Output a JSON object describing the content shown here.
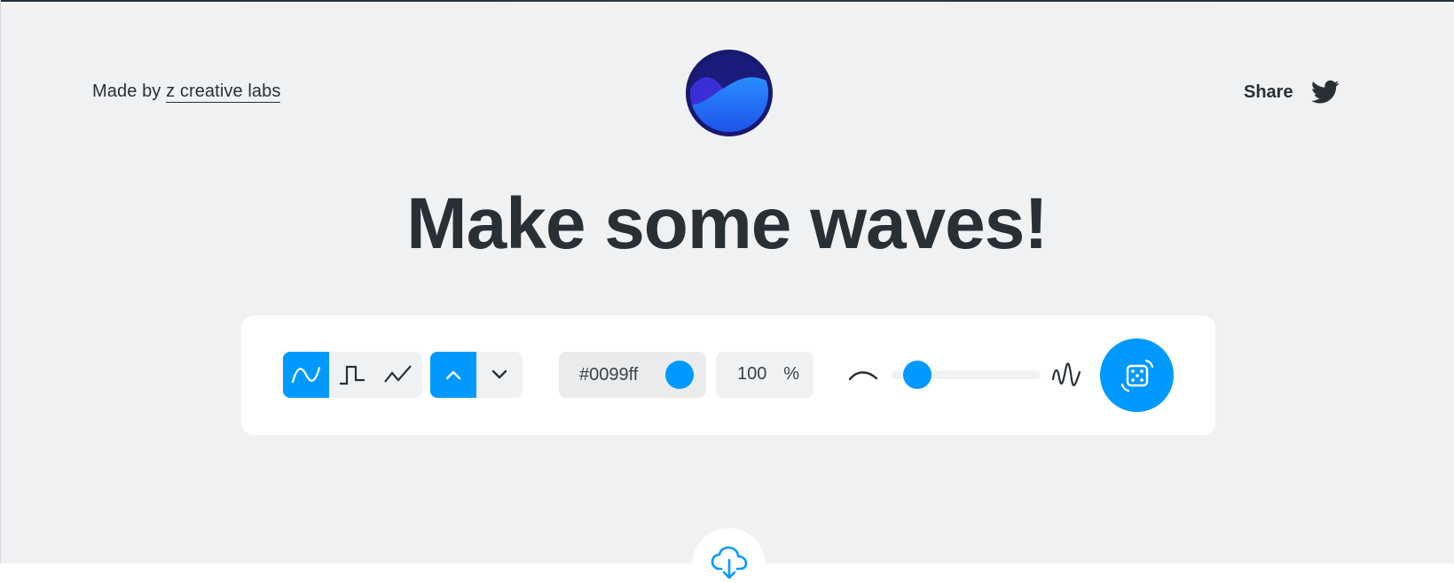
{
  "header": {
    "made_by_prefix": "Made by",
    "made_by_link": "z creative labs",
    "share_label": "Share",
    "share_icon": "twitter-icon"
  },
  "logo": {
    "icon": "wave-logo-icon"
  },
  "title": "Make some waves!",
  "toolbar": {
    "shapes": [
      {
        "name": "wave-shape-sine",
        "icon": "sine-wave-icon",
        "selected": true
      },
      {
        "name": "wave-shape-square",
        "icon": "square-wave-icon",
        "selected": false
      },
      {
        "name": "wave-shape-triangle",
        "icon": "triangle-wave-icon",
        "selected": false
      }
    ],
    "directions": [
      {
        "name": "direction-up",
        "icon": "chevron-up-icon",
        "selected": true
      },
      {
        "name": "direction-down",
        "icon": "chevron-down-icon",
        "selected": false
      }
    ],
    "color_value": "#0099ff",
    "opacity_value": "100",
    "opacity_unit": "%",
    "complexity": {
      "min_icon": "calm-wave-icon",
      "max_icon": "wild-wave-icon",
      "value": 0.17
    },
    "randomize_icon": "dice-icon"
  },
  "download_icon": "cloud-download-icon",
  "colors": {
    "accent": "#0099ff",
    "text": "#283035",
    "background": "#f0f1f3",
    "panel": "#ffffff"
  }
}
